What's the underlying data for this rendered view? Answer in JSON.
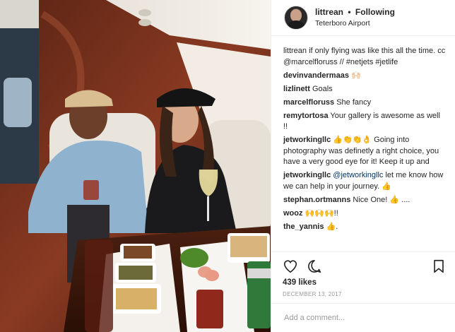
{
  "header": {
    "username": "littrean",
    "separator": "•",
    "follow_label": "Following",
    "location": "Teterboro Airport"
  },
  "caption": {
    "user": "littrean",
    "text_1": " if only flying was like this all the time. cc ",
    "mention": "@marcelfloruss",
    "text_2": " // ",
    "tag_1": "#netjets",
    "text_3": " ",
    "tag_2": "#jetlife"
  },
  "comments": [
    {
      "user": "devinvandermaas",
      "text": " 🙌🏻"
    },
    {
      "user": "lizlinett",
      "text": " Goals"
    },
    {
      "user": "marcelfloruss",
      "text": " She fancy"
    },
    {
      "user": "remytortosa",
      "text": " Your gallery is awesome as well !!"
    },
    {
      "user": "jetworkingllc",
      "text": " 👍👏👏👌 Going into photography was definetly a right choice, you have a very good eye for it! Keep it up and"
    },
    {
      "user": "jetworkingllc",
      "mention": " @jetworkingllc",
      "text": " let me know how we can help in your journey. 👍"
    },
    {
      "user": "stephan.ortmanns",
      "text": " Nice One! 👍 ...."
    },
    {
      "user": "wooz",
      "text": " 🙌🙌🙌!!"
    },
    {
      "user": "the_yannis",
      "text": " 👍."
    }
  ],
  "actions": {
    "like_icon": "heart-icon",
    "comment_icon": "comment-icon",
    "save_icon": "bookmark-icon"
  },
  "likes": "439 likes",
  "date": "DECEMBER 13, 2017",
  "add_comment_placeholder": "Add a comment...",
  "colors": {
    "link": "#003569",
    "muted": "#999999",
    "border": "#efefef",
    "text": "#262626"
  }
}
